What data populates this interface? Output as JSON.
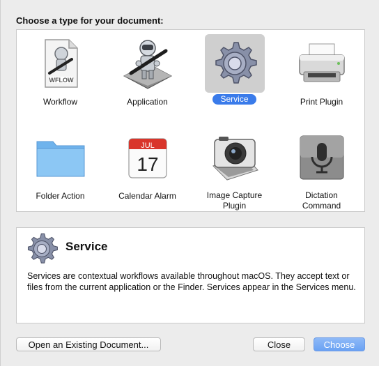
{
  "dialog": {
    "heading": "Choose a type for your document:"
  },
  "types": [
    {
      "label": "Workflow",
      "icon": "workflow-document-icon",
      "badge": "WFLOW",
      "selected": false
    },
    {
      "label": "Application",
      "icon": "automator-robot-icon",
      "selected": false
    },
    {
      "label": "Service",
      "icon": "gear-icon",
      "selected": true
    },
    {
      "label": "Print Plugin",
      "icon": "printer-icon",
      "selected": false
    },
    {
      "label": "Folder Action",
      "icon": "folder-icon",
      "selected": false
    },
    {
      "label": "Calendar Alarm",
      "icon": "calendar-icon",
      "calendar_month": "JUL",
      "calendar_day": "17",
      "selected": false
    },
    {
      "label": "Image Capture\nPlugin",
      "icon": "camera-icon",
      "selected": false
    },
    {
      "label": "Dictation\nCommand",
      "icon": "microphone-icon",
      "selected": false
    }
  ],
  "description": {
    "title": "Service",
    "icon": "gear-icon",
    "text": "Services are contextual workflows available throughout macOS. They accept text or files from the current application or the Finder. Services appear in the Services menu."
  },
  "buttons": {
    "open_existing": "Open an Existing Document...",
    "close": "Close",
    "choose": "Choose"
  },
  "colors": {
    "selection": "#3a7bea",
    "primary_button": "#6aa2f3"
  }
}
